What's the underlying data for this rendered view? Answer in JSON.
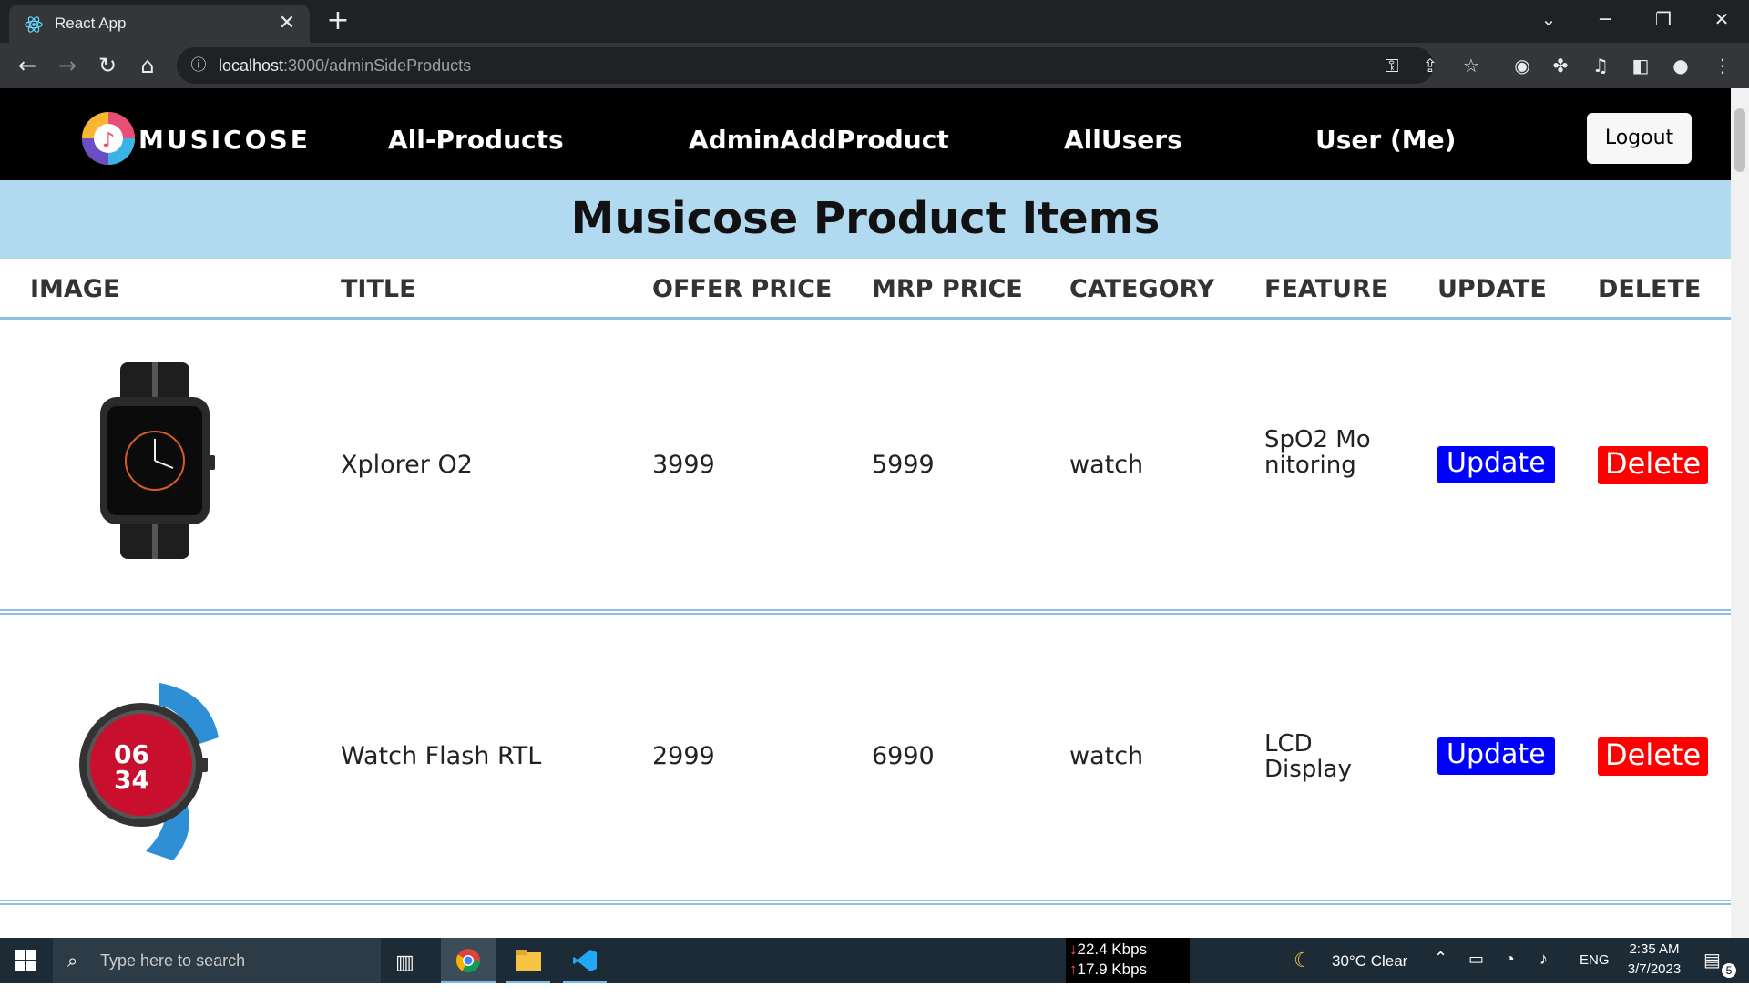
{
  "browser": {
    "tab_title": "React App",
    "url_host": "localhost",
    "url_rest": ":3000/adminSideProducts"
  },
  "navbar": {
    "logo_text": "MUSICOSE",
    "links": [
      "All-Products",
      "AdminAddProduct",
      "AllUsers",
      "User (Me)"
    ],
    "logout_label": "Logout"
  },
  "page": {
    "title": "Musicose Product Items"
  },
  "table": {
    "headers": [
      "IMAGE",
      "TITLE",
      "OFFER PRICE",
      "MRP PRICE",
      "CATEGORY",
      "FEATURE",
      "UPDATE",
      "DELETE"
    ],
    "rows": [
      {
        "title": "Xplorer O2",
        "offer_price": "3999",
        "mrp_price": "5999",
        "category": "watch",
        "feature": "SpO2 Monitoring",
        "update": "Update",
        "delete": "Delete"
      },
      {
        "title": "Watch Flash RTL",
        "offer_price": "2999",
        "mrp_price": "6990",
        "category": "watch",
        "feature": "LCD Display",
        "update": "Update",
        "delete": "Delete"
      }
    ]
  },
  "taskbar": {
    "search_placeholder": "Type here to search",
    "net_down": "22.4 Kbps",
    "net_up": "17.9 Kbps",
    "weather": "30°C  Clear",
    "lang": "ENG",
    "time": "2:35 AM",
    "date": "3/7/2023",
    "notif_count": "5"
  },
  "colors": {
    "banner": "#b1d9f0",
    "update_button": "#0000ff",
    "delete_button": "#ff0000",
    "row_divider": "#8ec0e2"
  }
}
